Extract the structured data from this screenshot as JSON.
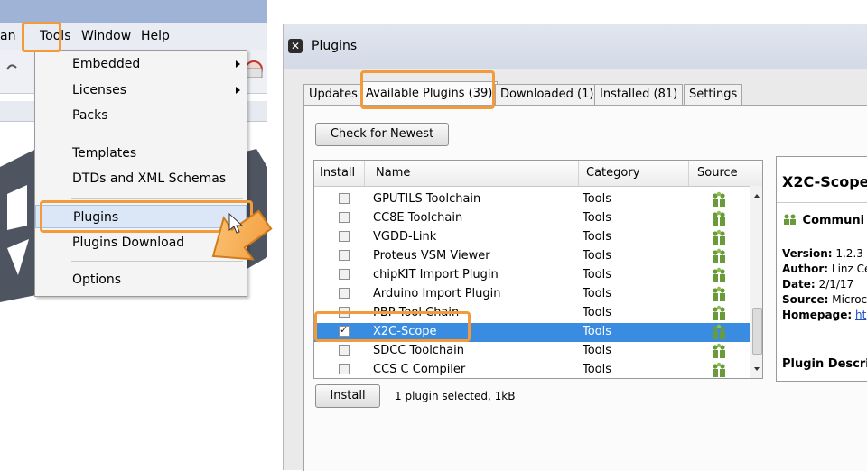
{
  "menubar": {
    "file_partial": "an",
    "tools": "Tools",
    "window": "Window",
    "help": "Help"
  },
  "tools_menu": {
    "items": [
      {
        "label": "Embedded",
        "submenu": true
      },
      {
        "label": "Licenses",
        "submenu": true
      },
      {
        "label": "Packs",
        "submenu": false
      },
      {
        "label": "Templates",
        "submenu": false
      },
      {
        "label": "DTDs and XML Schemas",
        "submenu": false
      },
      {
        "label": "Plugins",
        "submenu": false,
        "highlighted": true
      },
      {
        "label": "Plugins Download",
        "submenu": false
      },
      {
        "label": "Options",
        "submenu": false
      }
    ]
  },
  "dialog": {
    "title": "Plugins",
    "title_icon": "close-x-icon",
    "tabs": [
      {
        "label": "Updates"
      },
      {
        "label": "Available Plugins (39)",
        "active": true
      },
      {
        "label": "Downloaded (1)"
      },
      {
        "label": "Installed (81)"
      },
      {
        "label": "Settings"
      }
    ],
    "check_button": "Check for Newest",
    "columns": {
      "install": "Install",
      "name": "Name",
      "category": "Category",
      "source": "Source"
    },
    "rows": [
      {
        "name": "GPUTILS Toolchain",
        "category": "Tools",
        "checked": false,
        "selected": false
      },
      {
        "name": "CC8E Toolchain",
        "category": "Tools",
        "checked": false,
        "selected": false
      },
      {
        "name": "VGDD-Link",
        "category": "Tools",
        "checked": false,
        "selected": false
      },
      {
        "name": "Proteus VSM Viewer",
        "category": "Tools",
        "checked": false,
        "selected": false
      },
      {
        "name": "chipKIT Import Plugin",
        "category": "Tools",
        "checked": false,
        "selected": false
      },
      {
        "name": "Arduino Import Plugin",
        "category": "Tools",
        "checked": false,
        "selected": false
      },
      {
        "name": "PBP Tool Chain",
        "category": "Tools",
        "checked": false,
        "selected": false
      },
      {
        "name": "X2C-Scope",
        "category": "Tools",
        "checked": true,
        "selected": true
      },
      {
        "name": "SDCC Toolchain",
        "category": "Tools",
        "checked": false,
        "selected": false
      },
      {
        "name": "CCS C Compiler",
        "category": "Tools",
        "checked": false,
        "selected": false
      }
    ],
    "source_icon": "community-people-icon",
    "install_button": "Install",
    "status": "1 plugin selected, 1kB",
    "detail": {
      "title": "X2C-Scope",
      "community": "Communi",
      "version_label": "Version:",
      "version_value": "1.2.3",
      "author_label": "Author:",
      "author_value": "Linz Ce",
      "date_label": "Date:",
      "date_value": "2/1/17",
      "source_label": "Source:",
      "source_value": "Microc",
      "homepage_label": "Homepage:",
      "homepage_value": "ht",
      "description_label": "Plugin Descrip"
    }
  },
  "colors": {
    "highlight_orange": "#f39b3a",
    "selection_blue": "#3a8ce0",
    "menu_highlight": "#dbe6f6",
    "link_blue": "#1a4fc9"
  }
}
